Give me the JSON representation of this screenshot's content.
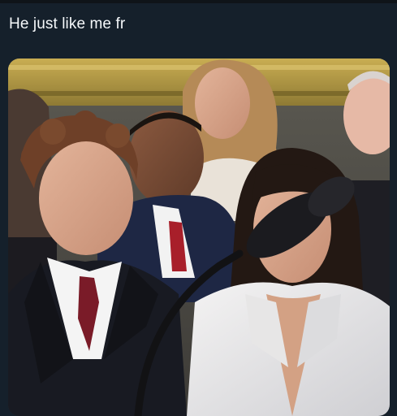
{
  "post": {
    "text": "He just like me fr"
  },
  "media": {
    "kind": "photo",
    "icon": "photo-icon"
  },
  "colors": {
    "background": "#15202b",
    "text": "#f5f8fa"
  }
}
